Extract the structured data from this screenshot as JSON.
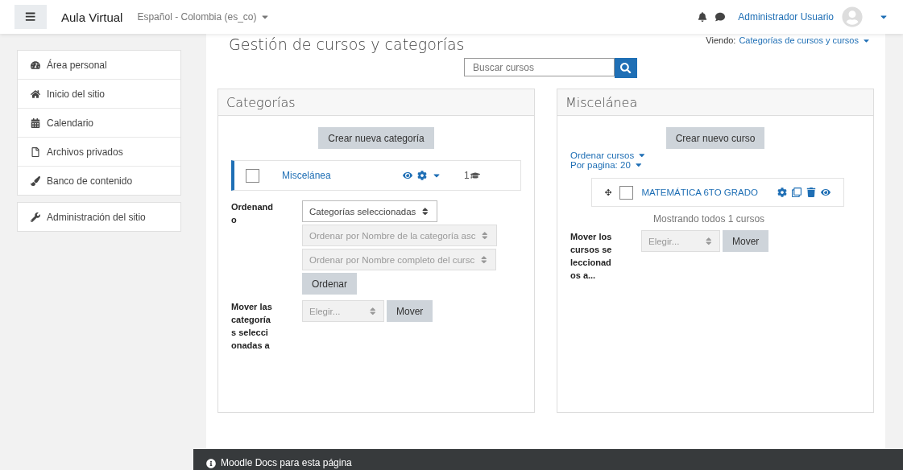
{
  "navbar": {
    "site_name": "Aula Virtual",
    "language": "Español - Colombia (es_co)",
    "user_name": "Administrador Usuario"
  },
  "sidebar": {
    "groups": [
      [
        "Área personal",
        "Inicio del sitio",
        "Calendario",
        "Archivos privados",
        "Banco de contenido"
      ],
      [
        "Administración del sitio"
      ]
    ]
  },
  "page": {
    "title": "Gestión de cursos y categorías",
    "viewing_label": "Viendo:",
    "viewing_value": "Categorías de cursos y cursos",
    "search_placeholder": "Buscar cursos"
  },
  "categories_panel": {
    "title": "Categorías",
    "create_button": "Crear nueva categoría",
    "categories": [
      {
        "name": "Miscelánea",
        "checked": false,
        "selected": true,
        "course_count": "1"
      }
    ],
    "sort_label": "Ordenando",
    "sort_selects": [
      {
        "value": "Categorías seleccionadas",
        "disabled": false
      },
      {
        "value": "Ordenar por Nombre de la categoría asc",
        "disabled": true
      },
      {
        "value": "Ordenar por Nombre completo del cursc",
        "disabled": true
      }
    ],
    "sort_button": "Ordenar",
    "move_label": "Mover las categorías seleccionadas a",
    "move_select": "Elegir...",
    "move_button": "Mover"
  },
  "courses_panel": {
    "title": "Miscelánea",
    "create_button": "Crear nuevo curso",
    "sort_link": "Ordenar cursos",
    "per_page_link": "Por pagina: 20",
    "courses": [
      {
        "name": "MATEMÁTICA 6TO GRADO",
        "checked": false
      }
    ],
    "showing": "Mostrando todos 1 cursos",
    "move_label": "Mover los cursos seleccionados a...",
    "move_select": "Elegir...",
    "move_button": "Mover"
  },
  "footer": {
    "docs_link": "Moodle Docs para esta página"
  }
}
